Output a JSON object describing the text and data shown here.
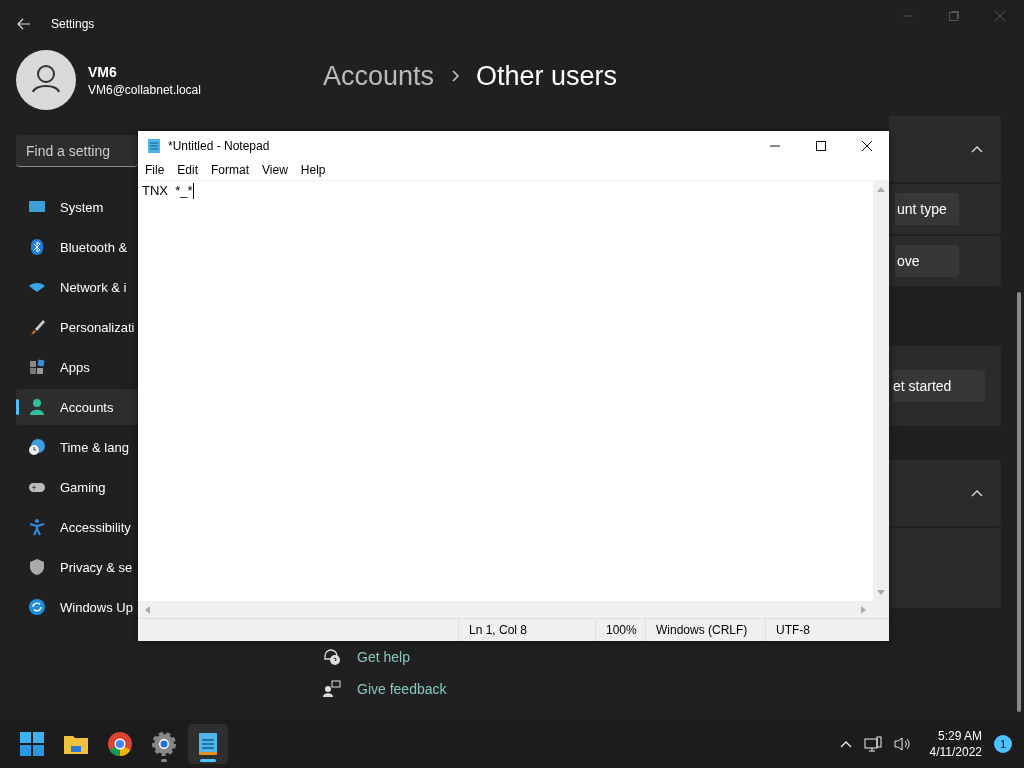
{
  "settings": {
    "title": "Settings",
    "user": {
      "name": "VM6",
      "email": "VM6@collabnet.local"
    },
    "search": {
      "placeholder": "Find a setting"
    },
    "nav": [
      {
        "label": "System",
        "kind": "system",
        "selected": false
      },
      {
        "label": "Bluetooth &",
        "kind": "bluetooth",
        "selected": false
      },
      {
        "label": "Network & i",
        "kind": "network",
        "selected": false
      },
      {
        "label": "Personalizati",
        "kind": "personalization",
        "selected": false
      },
      {
        "label": "Apps",
        "kind": "apps",
        "selected": false
      },
      {
        "label": "Accounts",
        "kind": "accounts",
        "selected": true
      },
      {
        "label": "Time & lang",
        "kind": "time",
        "selected": false
      },
      {
        "label": "Gaming",
        "kind": "gaming",
        "selected": false
      },
      {
        "label": "Accessibility",
        "kind": "accessibility",
        "selected": false
      },
      {
        "label": "Privacy & se",
        "kind": "privacy",
        "selected": false
      },
      {
        "label": "Windows Up",
        "kind": "update",
        "selected": false
      }
    ],
    "breadcrumb": {
      "parent": "Accounts",
      "current": "Other users"
    },
    "sections": [
      {
        "kind": "expander",
        "expanded": true,
        "rows": [
          {
            "kind": "button",
            "button": "unt type"
          },
          {
            "kind": "button",
            "button": "ove"
          }
        ]
      },
      {
        "kind": "card",
        "rows": [
          {
            "kind": "button",
            "button": "et started"
          }
        ]
      },
      {
        "kind": "expander",
        "expanded": true,
        "rows": [
          {
            "kind": "empty"
          }
        ]
      }
    ],
    "links": [
      {
        "label": "Get help",
        "kind": "help"
      },
      {
        "label": "Give feedback",
        "kind": "feedback"
      }
    ]
  },
  "notepad": {
    "title": "*Untitled - Notepad",
    "menu": [
      "File",
      "Edit",
      "Format",
      "View",
      "Help"
    ],
    "text": "TNX  *_*",
    "status": [
      "Ln 1, Col 8",
      "100%",
      "Windows (CRLF)",
      "UTF-8"
    ]
  },
  "taskbar": {
    "apps": [
      {
        "kind": "start",
        "running": false,
        "active": false
      },
      {
        "kind": "explorer",
        "running": false,
        "active": false
      },
      {
        "kind": "chrome",
        "running": false,
        "active": false
      },
      {
        "kind": "settings",
        "running": true,
        "active": false
      },
      {
        "kind": "notepad",
        "running": true,
        "active": true
      }
    ],
    "time": "5:29 AM",
    "date": "4/11/2022",
    "badge": "1"
  }
}
